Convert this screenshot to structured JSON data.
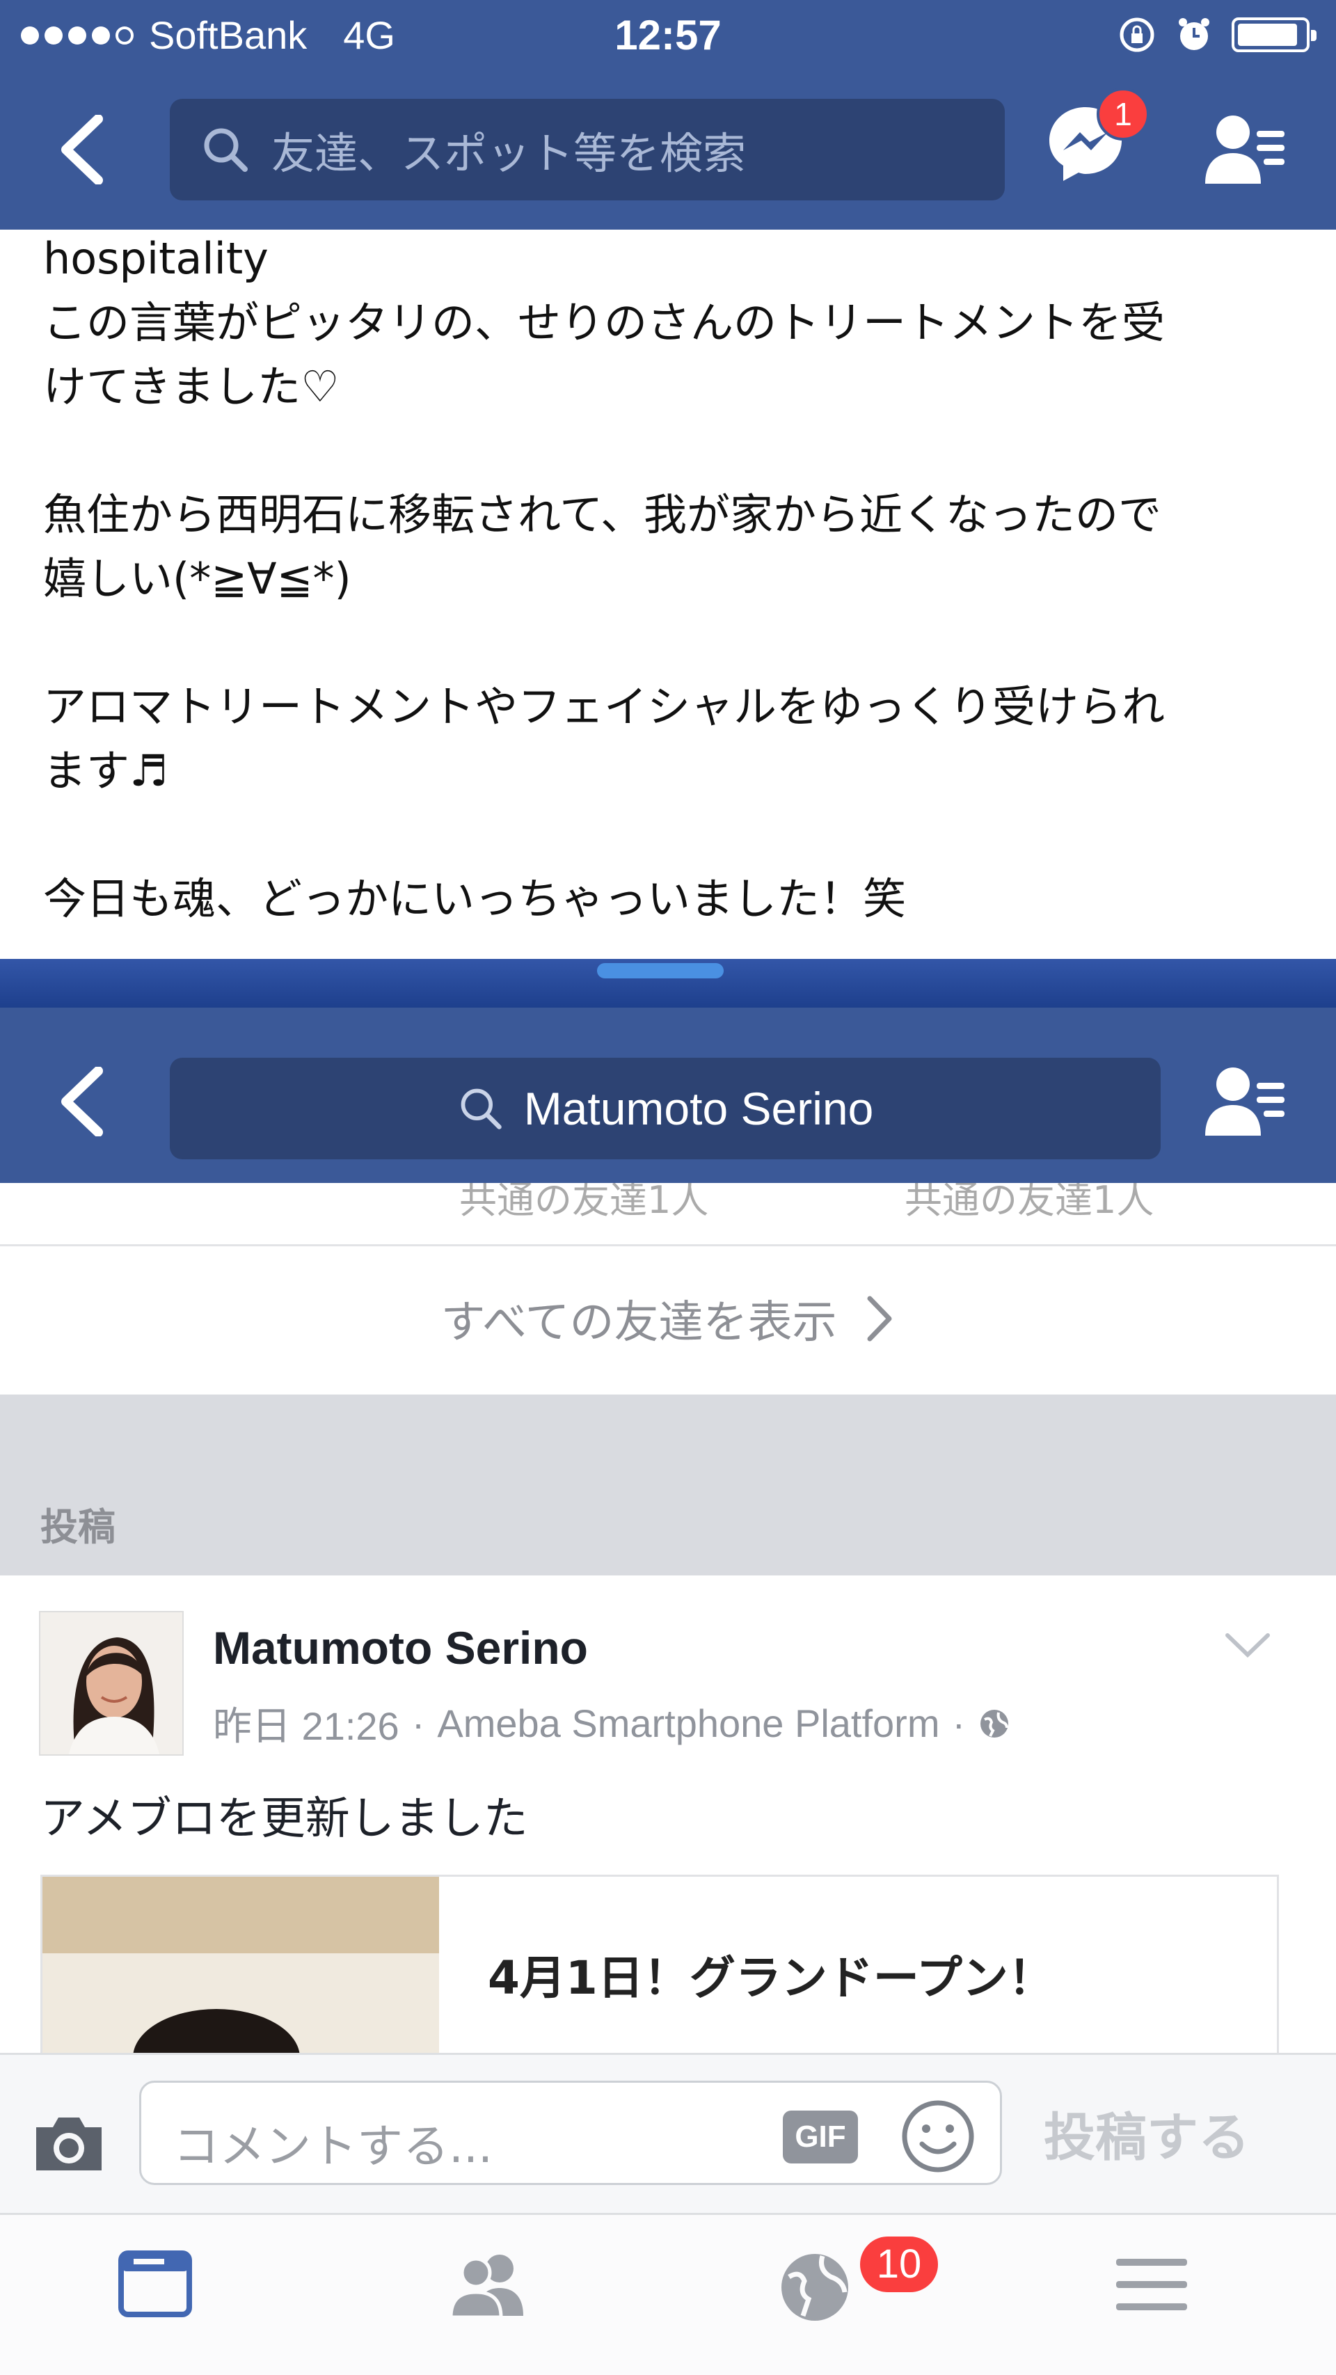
{
  "status_bar": {
    "carrier": "SoftBank",
    "network": "4G",
    "time": "12:57",
    "battery_level": 0.9
  },
  "nav_top": {
    "search_placeholder": "友達、スポット等を検索",
    "messenger_badge": "1"
  },
  "post_text": {
    "lines": [
      "hospitality",
      "この言葉がピッタリの、せりのさんのトリートメントを受",
      "けてきました♡",
      "",
      "魚住から西明石に移転されて、我が家から近くなったので",
      "嬉しい(*≧∀≦*)",
      "",
      "アロマトリートメントやフェイシャルをゆっくり受けられ",
      "ます♬",
      "",
      "今日も魂、どっかにいっちゃっいました！笑"
    ]
  },
  "nav_second": {
    "search_value": "Matumoto Serino"
  },
  "profile": {
    "faded_left": "共通の友達1人",
    "faded_right": "共通の友達1人",
    "show_all_friends": "すべての友達を表示",
    "posts_heading": "投稿"
  },
  "post": {
    "author": "Matumoto Serino",
    "time": "昨日 21:26",
    "source": "Ameba Smartphone Platform",
    "separator": "·",
    "body": "アメブロを更新しました",
    "link_title": "4月1日！グランドープン！"
  },
  "comment_bar": {
    "placeholder": "コメントする...",
    "gif_label": "GIF",
    "post_button": "投稿する"
  },
  "tab_bar": {
    "notifications_badge": "10",
    "icons": [
      "news-feed-icon",
      "friends-icon",
      "globe-icon",
      "menu-icon"
    ]
  },
  "colors": {
    "brand": "#3b5998",
    "badge": "#fa3e3e",
    "active_tab": "#4267b2"
  }
}
